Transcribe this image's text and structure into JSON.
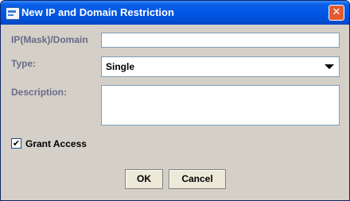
{
  "window": {
    "title": "New IP and Domain Restriction",
    "close_label": "✕"
  },
  "form": {
    "ip_label": "IP(Mask)/Domain",
    "ip_value": "",
    "type_label": "Type:",
    "type_value": "Single",
    "description_label": "Description:",
    "description_value": "",
    "grant_access_label": "Grant Access",
    "grant_access_checked": true,
    "check_mark": "✔"
  },
  "buttons": {
    "ok_label": "OK",
    "cancel_label": "Cancel"
  }
}
